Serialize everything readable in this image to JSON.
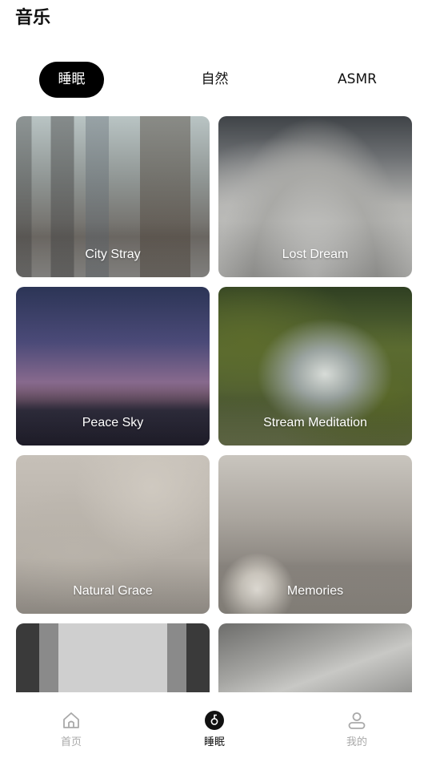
{
  "page": {
    "title": "音乐"
  },
  "tabs": [
    {
      "label": "睡眠",
      "active": true
    },
    {
      "label": "自然",
      "active": false
    },
    {
      "label": "ASMR",
      "active": false
    }
  ],
  "cards": [
    {
      "label": "City Stray",
      "image": "city-street-image"
    },
    {
      "label": "Lost Dream",
      "image": "misty-mountains-image"
    },
    {
      "label": "Peace Sky",
      "image": "night-sky-forest-image"
    },
    {
      "label": "Stream Meditation",
      "image": "forest-stream-image"
    },
    {
      "label": "Natural Grace",
      "image": "botanical-pattern-image"
    },
    {
      "label": "Memories",
      "image": "lamp-room-image"
    },
    {
      "label": "",
      "image": "library-window-image"
    },
    {
      "label": "",
      "image": "shoreline-image"
    }
  ],
  "tabbar": {
    "items": [
      {
        "label": "首页",
        "icon": "home-icon",
        "active": false
      },
      {
        "label": "睡眠",
        "icon": "sleep-icon",
        "active": true
      },
      {
        "label": "我的",
        "icon": "profile-icon",
        "active": false
      }
    ]
  },
  "colors": {
    "active_tab_bg": "#000000",
    "inactive_nav": "#a9a9a9"
  }
}
